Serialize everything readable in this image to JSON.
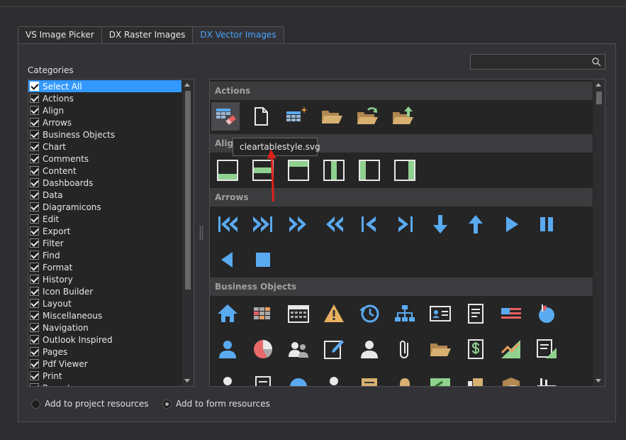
{
  "tabs": [
    {
      "label": "VS Image Picker"
    },
    {
      "label": "DX Raster Images"
    },
    {
      "label": "DX Vector Images"
    }
  ],
  "active_tab": 2,
  "search": {
    "value": "",
    "placeholder": ""
  },
  "categories_label": "Categories",
  "categories": [
    {
      "label": "Select All",
      "checked": true,
      "selected": true
    },
    {
      "label": "Actions",
      "checked": true
    },
    {
      "label": "Align",
      "checked": true
    },
    {
      "label": "Arrows",
      "checked": true
    },
    {
      "label": "Business Objects",
      "checked": true
    },
    {
      "label": "Chart",
      "checked": true
    },
    {
      "label": "Comments",
      "checked": true
    },
    {
      "label": "Content",
      "checked": true
    },
    {
      "label": "Dashboards",
      "checked": true
    },
    {
      "label": "Data",
      "checked": true
    },
    {
      "label": "Diagramicons",
      "checked": true
    },
    {
      "label": "Edit",
      "checked": true
    },
    {
      "label": "Export",
      "checked": true
    },
    {
      "label": "Filter",
      "checked": true
    },
    {
      "label": "Find",
      "checked": true
    },
    {
      "label": "Format",
      "checked": true
    },
    {
      "label": "History",
      "checked": true
    },
    {
      "label": "Icon Builder",
      "checked": true
    },
    {
      "label": "Layout",
      "checked": true
    },
    {
      "label": "Miscellaneous",
      "checked": true
    },
    {
      "label": "Navigation",
      "checked": true
    },
    {
      "label": "Outlook Inspired",
      "checked": true
    },
    {
      "label": "Pages",
      "checked": true
    },
    {
      "label": "Pdf Viewer",
      "checked": true
    },
    {
      "label": "Print",
      "checked": true
    },
    {
      "label": "Reports",
      "checked": true
    }
  ],
  "gallery": {
    "groups": [
      {
        "header": "Actions"
      },
      {
        "header": "Align"
      },
      {
        "header": "Arrows"
      },
      {
        "header": "Business Objects"
      }
    ]
  },
  "tooltip": "cleartablestyle.svg",
  "radios": [
    {
      "label": "Add to project resources",
      "checked": false
    },
    {
      "label": "Add to form resources",
      "checked": true
    }
  ],
  "colors": {
    "accent": "#3399ff",
    "icon_blue": "#5aaaf0",
    "icon_green": "#8fd18f",
    "icon_orange": "#e8a060",
    "icon_folder": "#c8a060"
  }
}
